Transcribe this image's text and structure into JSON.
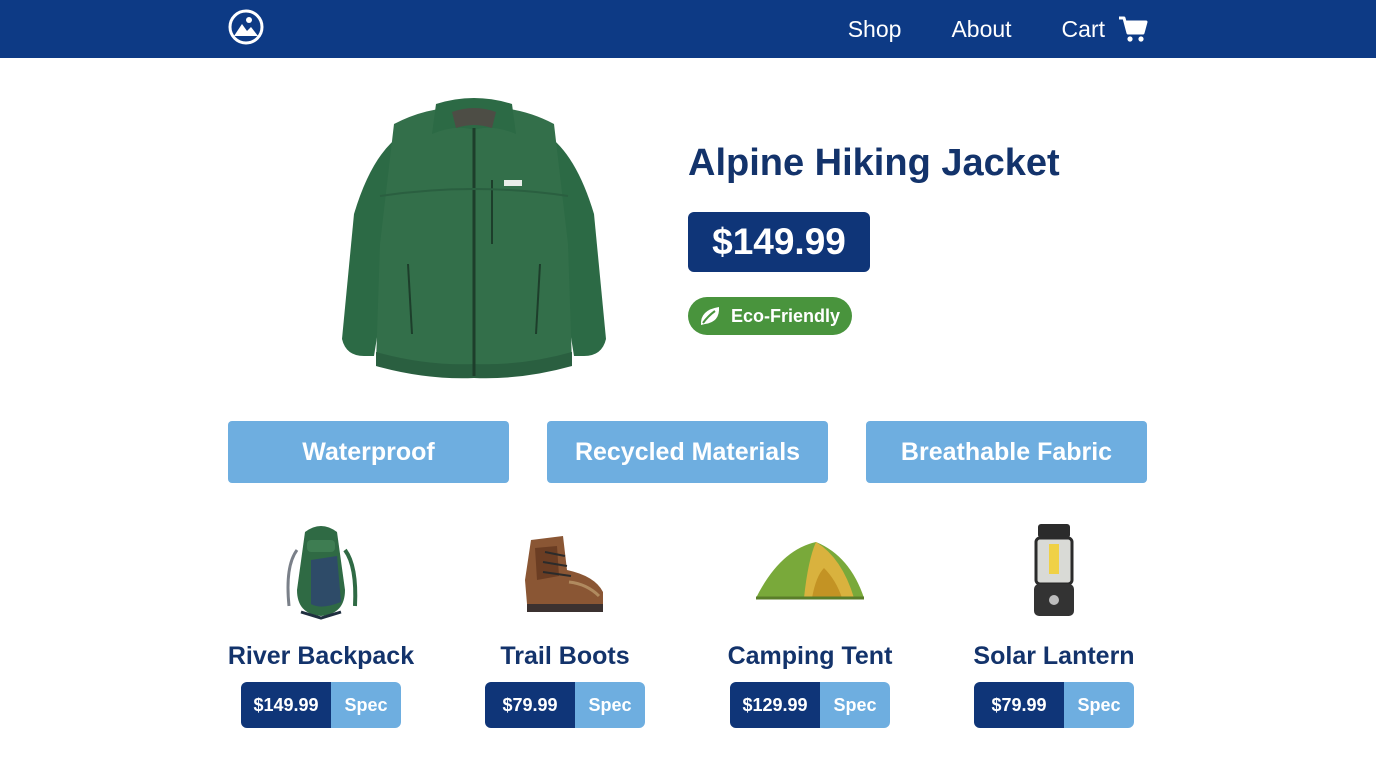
{
  "nav": {
    "logo": "mountain-logo-icon",
    "links": [
      "Shop",
      "About",
      "Cart"
    ],
    "cart_icon": "cart-icon"
  },
  "hero": {
    "image": "green-jacket-image",
    "title": "Alpine Hiking Jacket",
    "price": "$149.99",
    "badge": "Eco-Friendly",
    "badge_icon": "leaf-icon"
  },
  "features": [
    "Waterproof",
    "Recycled Materials",
    "Breathable Fabric"
  ],
  "products": [
    {
      "name": "River Backpack",
      "price": "$149.99",
      "spec": "Spec",
      "image": "backpack-image"
    },
    {
      "name": "Trail Boots",
      "price": "$79.99",
      "spec": "Spec",
      "image": "boots-image"
    },
    {
      "name": "Camping Tent",
      "price": "$129.99",
      "spec": "Spec",
      "image": "tent-image"
    },
    {
      "name": "Solar Lantern",
      "price": "$79.99",
      "spec": "Spec",
      "image": "lantern-image"
    }
  ],
  "colors": {
    "nav_bg": "#0d3a85",
    "primary": "#0f3578",
    "accent": "#6eaee0",
    "eco_green": "#49943d",
    "text": "#13336b"
  }
}
